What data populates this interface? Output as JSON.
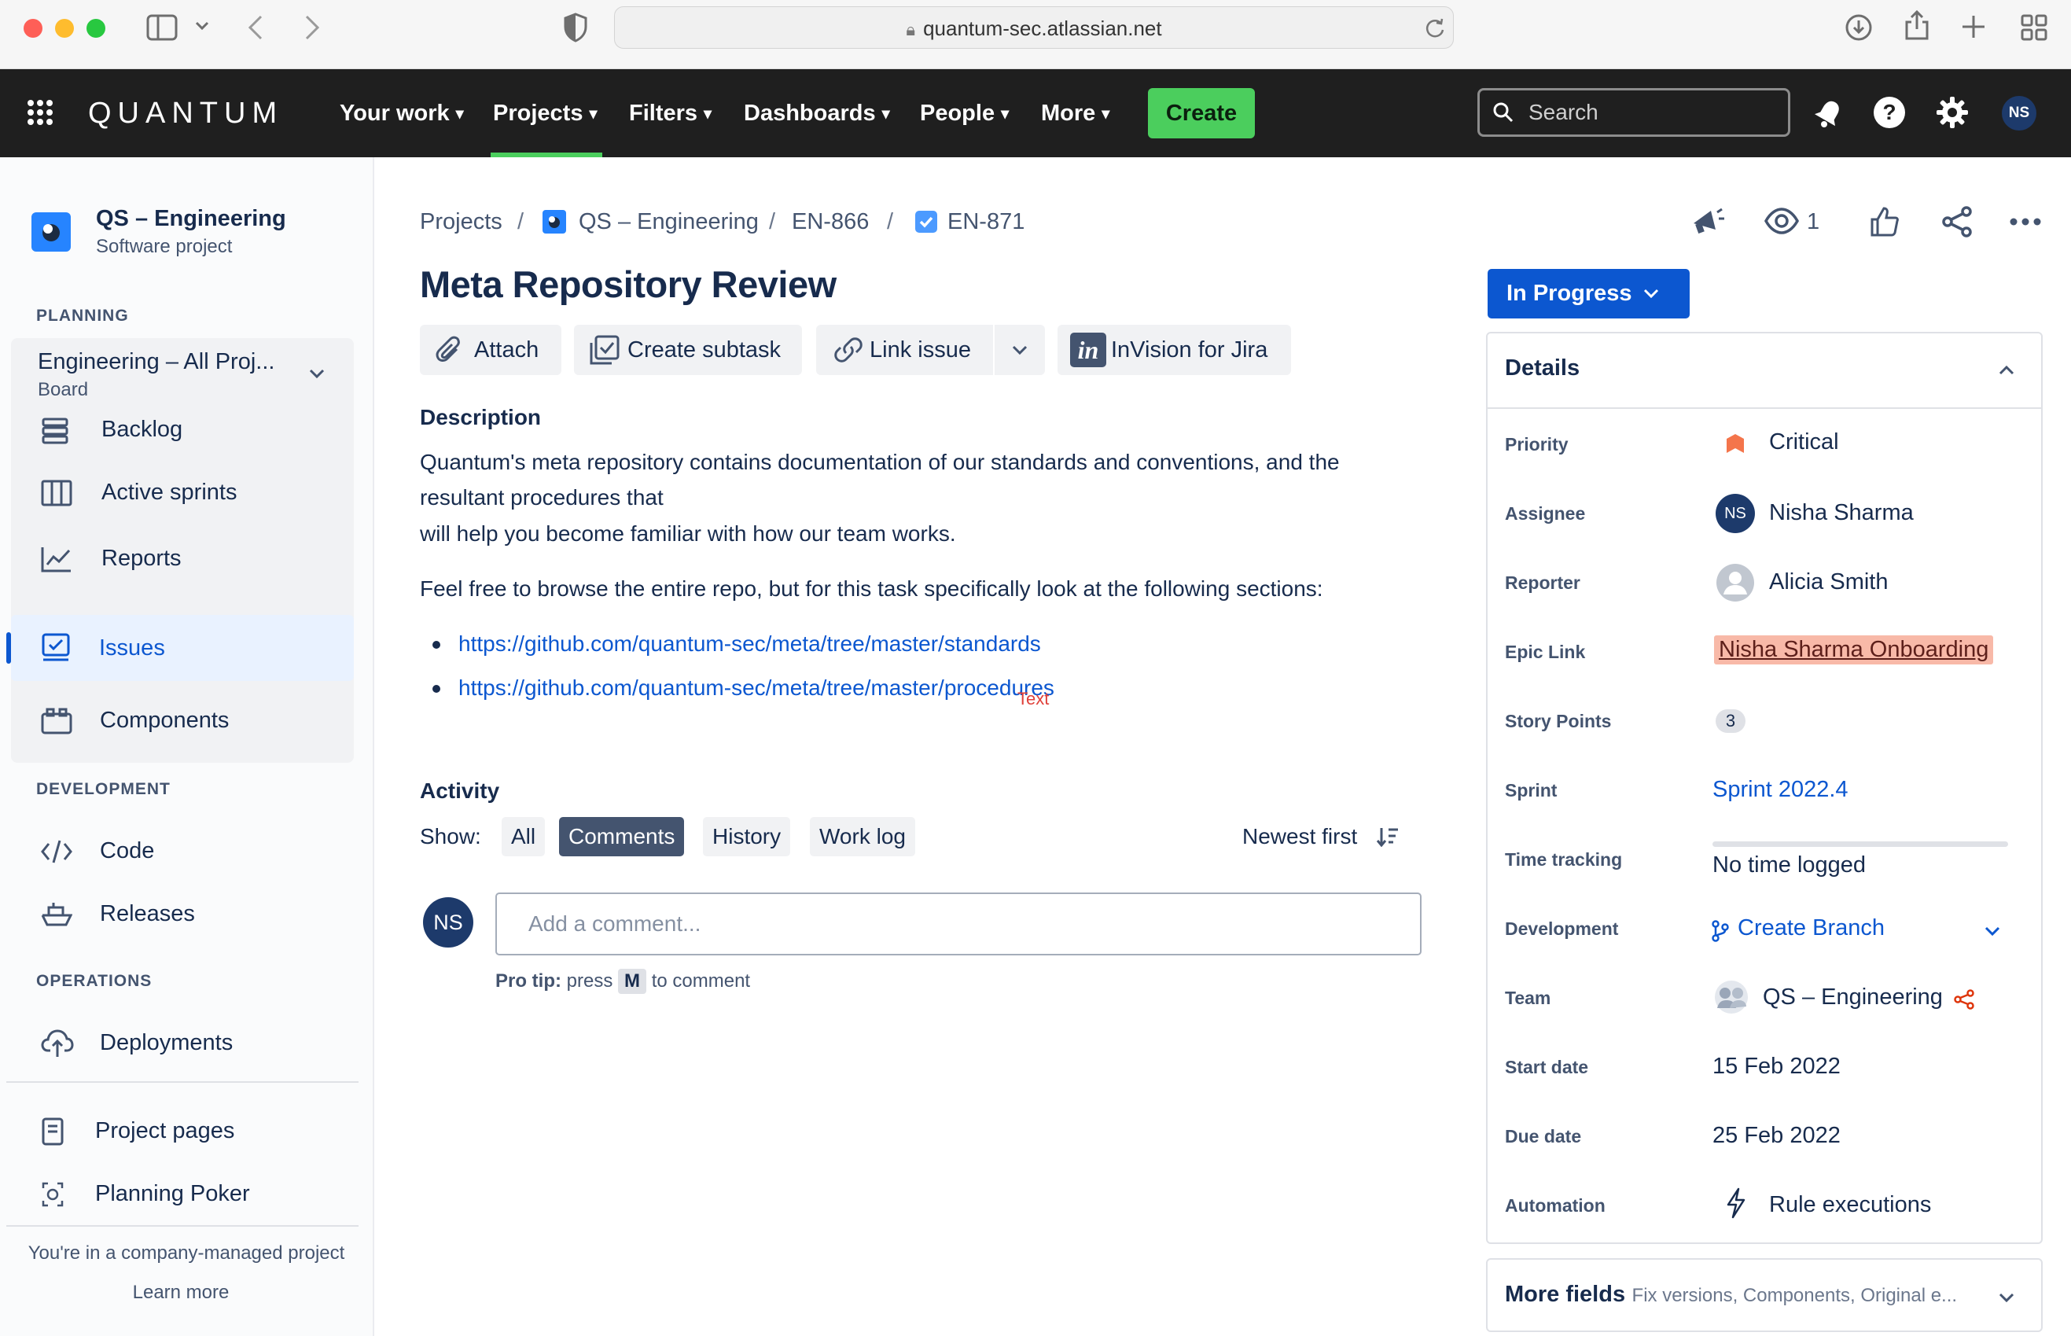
{
  "browser": {
    "url": "quantum-sec.atlassian.net"
  },
  "topnav": {
    "logo_text": "QUANTUM",
    "items": [
      "Your work",
      "Projects",
      "Filters",
      "Dashboards",
      "People",
      "More"
    ],
    "active_item": "Projects",
    "create_label": "Create",
    "search_placeholder": "Search",
    "avatar_initials": "NS"
  },
  "sidebar": {
    "project_name": "QS – Engineering",
    "project_type": "Software project",
    "planning_heading": "PLANNING",
    "board_name": "Engineering – All Proj...",
    "board_sub": "Board",
    "planning_items": [
      "Backlog",
      "Active sprints",
      "Reports"
    ],
    "issues_label": "Issues",
    "components_label": "Components",
    "development_heading": "DEVELOPMENT",
    "development_items": [
      "Code",
      "Releases"
    ],
    "operations_heading": "OPERATIONS",
    "operations_items": [
      "Deployments"
    ],
    "extra_items": [
      "Project pages",
      "Planning Poker"
    ],
    "footer_text": "You're in a company-managed project",
    "learn_more": "Learn more"
  },
  "breadcrumb": {
    "items": [
      "Projects",
      "QS – Engineering",
      "EN-866",
      "EN-871"
    ],
    "separator": "/"
  },
  "issue": {
    "title": "Meta Repository Review",
    "toolbar": {
      "attach": "Attach",
      "create_subtask": "Create subtask",
      "link_issue": "Link issue",
      "invision": "InVision for Jira"
    },
    "description_heading": "Description",
    "description_line1": "Quantum's meta repository contains documentation of our standards and conventions, and the",
    "description_line2": "resultant procedures that",
    "description_line3": "will help you become familiar with how our team works.",
    "description_line4": "Feel free to browse the entire repo, but for this task specifically look at the following sections:",
    "links": [
      "https://github.com/quantum-sec/meta/tree/master/standards",
      "https://github.com/quantum-sec/meta/tree/master/procedures"
    ],
    "stray_text": "Text"
  },
  "activity": {
    "heading": "Activity",
    "show_label": "Show:",
    "tabs": [
      "All",
      "Comments",
      "History",
      "Work log"
    ],
    "active_tab": "Comments",
    "sort_label": "Newest first",
    "comment_placeholder": "Add a comment...",
    "avatar_initials": "NS",
    "protip_bold": "Pro tip:",
    "protip_press": "press",
    "protip_key": "M",
    "protip_rest": "to comment"
  },
  "header_actions": {
    "watch_count": "1"
  },
  "status": {
    "label": "In Progress",
    "color": "#0c57d0"
  },
  "details": {
    "heading": "Details",
    "fields": {
      "priority": {
        "label": "Priority",
        "value": "Critical"
      },
      "assignee": {
        "label": "Assignee",
        "value": "Nisha Sharma",
        "initials": "NS"
      },
      "reporter": {
        "label": "Reporter",
        "value": "Alicia Smith"
      },
      "epic_link": {
        "label": "Epic Link",
        "value": "Nisha Sharma Onboarding",
        "color": "#f8b9a8"
      },
      "story_points": {
        "label": "Story Points",
        "value": "3"
      },
      "sprint": {
        "label": "Sprint",
        "value": "Sprint 2022.4"
      },
      "time_tracking": {
        "label": "Time tracking",
        "value": "No time logged"
      },
      "development": {
        "label": "Development",
        "value": "Create Branch"
      },
      "team": {
        "label": "Team",
        "value": "QS – Engineering"
      },
      "start_date": {
        "label": "Start date",
        "value": "15 Feb 2022"
      },
      "due_date": {
        "label": "Due date",
        "value": "25 Feb 2022"
      },
      "automation": {
        "label": "Automation",
        "value": "Rule executions"
      }
    }
  },
  "more_fields": {
    "label": "More fields",
    "hint": "Fix versions, Components, Original e..."
  },
  "colors": {
    "nav_bg": "#1f1f1f",
    "create_green": "#4bce5d",
    "link_blue": "#0c57d0",
    "priority_orange": "#f4754b"
  }
}
